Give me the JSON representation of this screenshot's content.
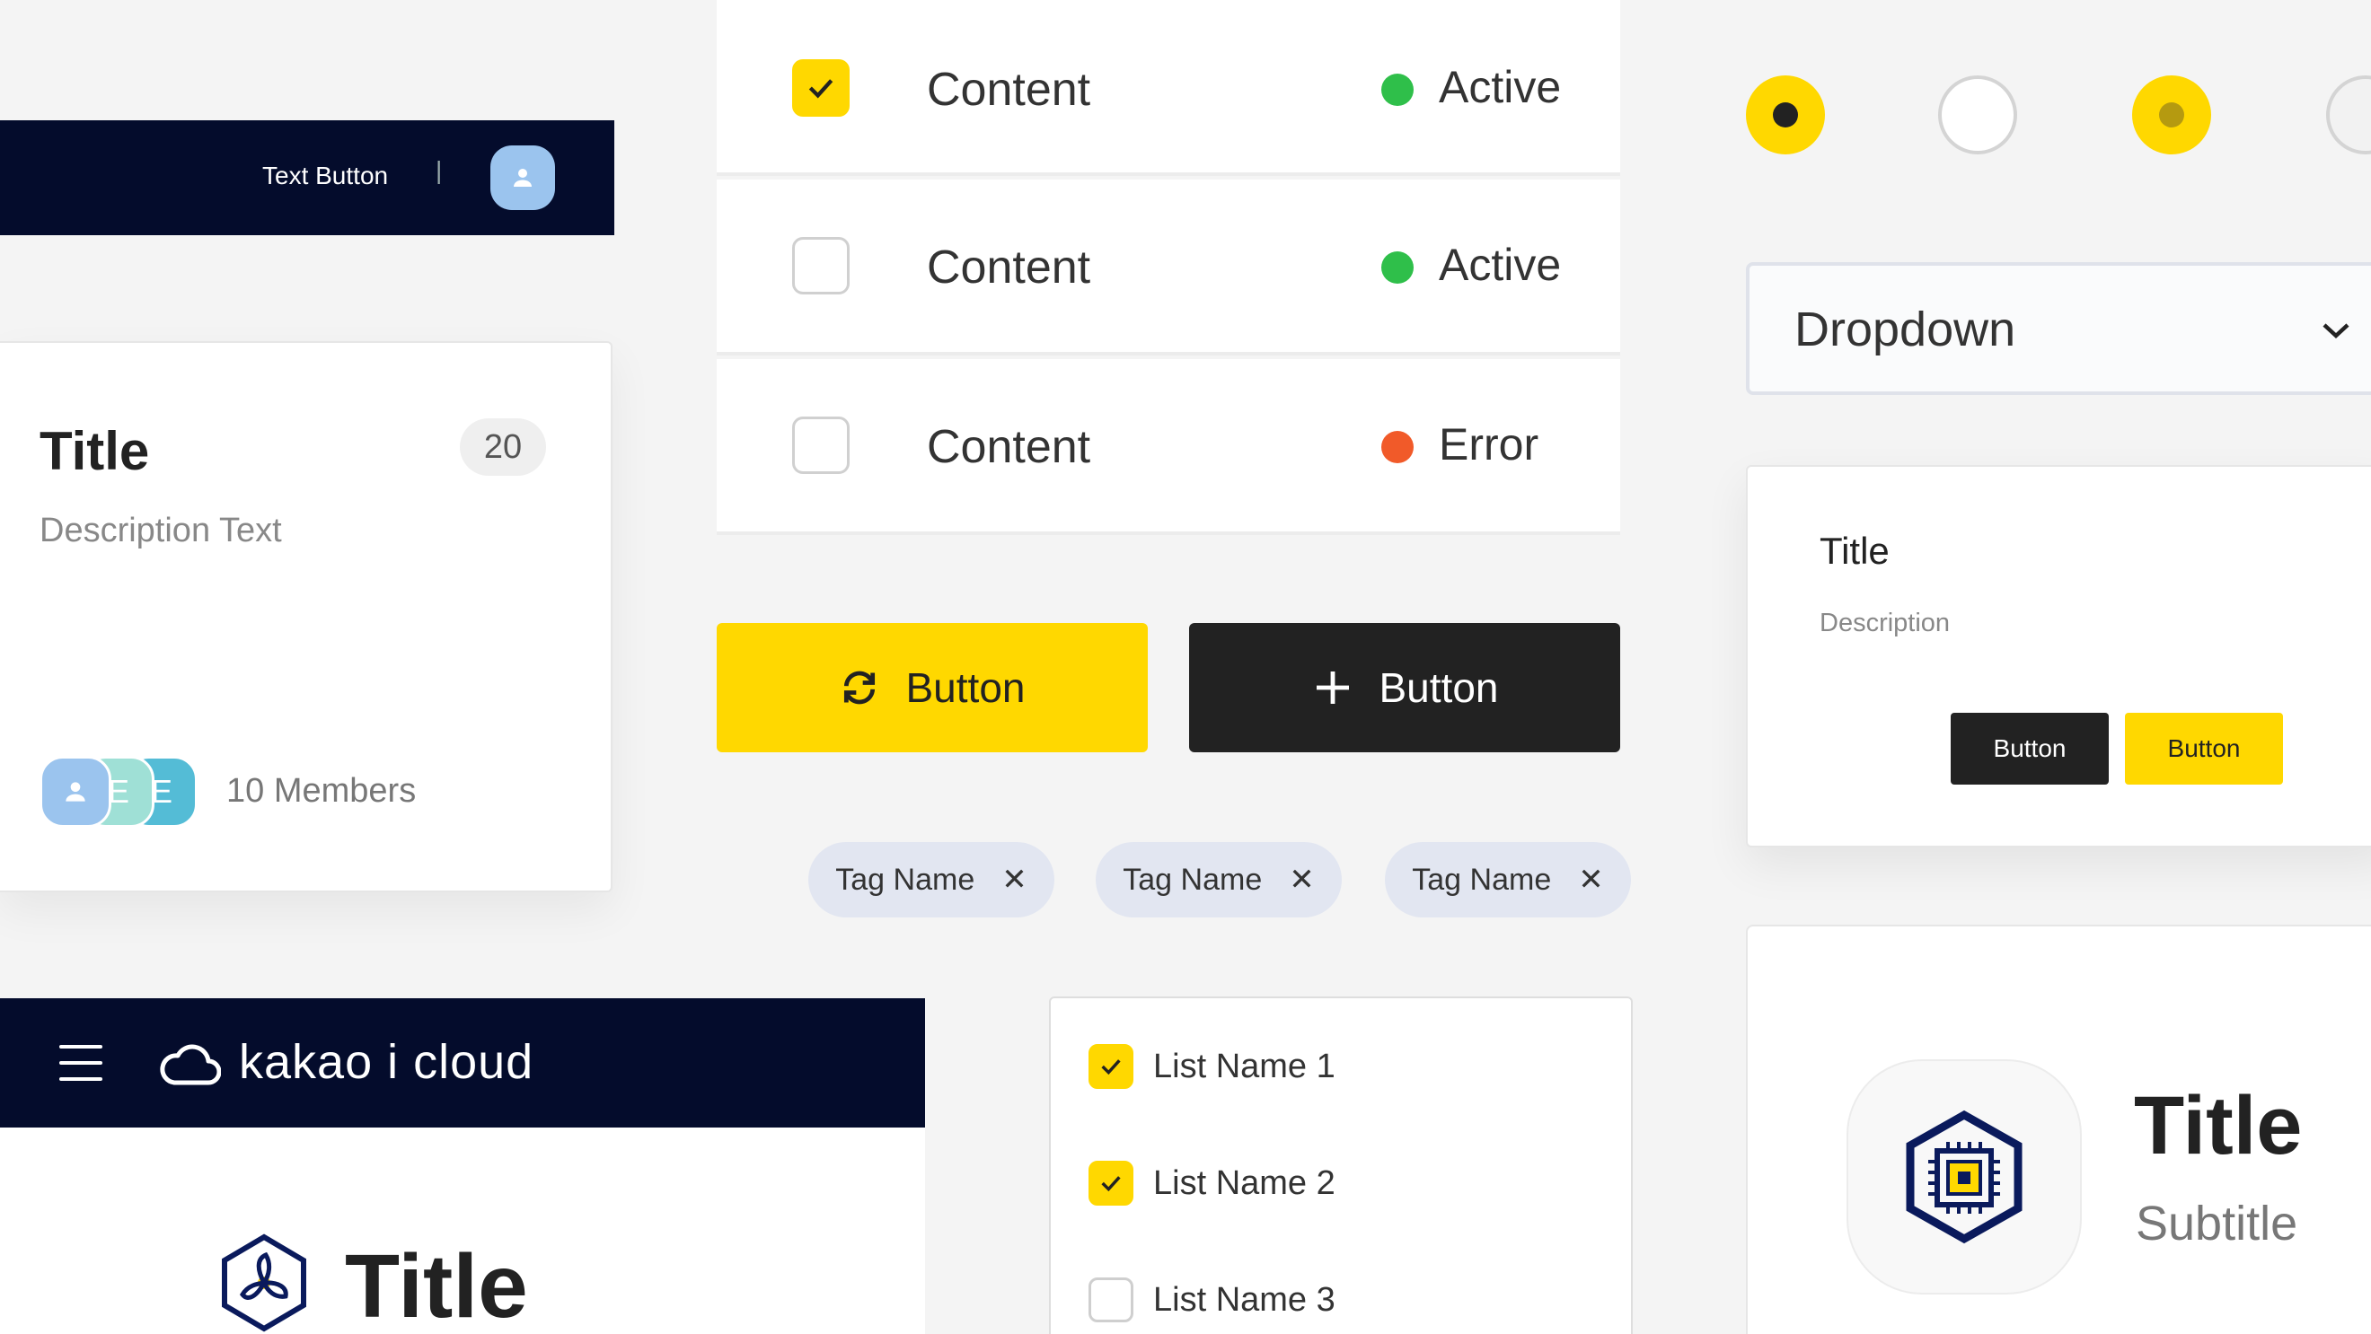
{
  "top_header": {
    "text_button": "Text Button",
    "separator": "|"
  },
  "member_card": {
    "title": "Title",
    "count": "20",
    "description": "Description Text",
    "members_label": "10 Members",
    "avatar_letters": [
      "E",
      "E"
    ]
  },
  "table": {
    "rows": [
      {
        "content": "Content",
        "checked": true,
        "status": "Active",
        "status_color": "#2fbf4a"
      },
      {
        "content": "Content",
        "checked": false,
        "status": "Active",
        "status_color": "#2fbf4a"
      },
      {
        "content": "Content",
        "checked": false,
        "status": "Error",
        "status_color": "#f15a29"
      }
    ]
  },
  "buttons": {
    "refresh_label": "Button",
    "add_label": "Button"
  },
  "tags": [
    {
      "label": "Tag Name"
    },
    {
      "label": "Tag Name"
    },
    {
      "label": "Tag Name"
    }
  ],
  "app_header": {
    "brand": "kakao i cloud"
  },
  "app_panel": {
    "title": "Title"
  },
  "list": {
    "items": [
      {
        "label": "List Name 1",
        "checked": true
      },
      {
        "label": "List Name 2",
        "checked": true
      },
      {
        "label": "List Name 3",
        "checked": false
      }
    ]
  },
  "radios": [
    {
      "state": "selected"
    },
    {
      "state": "unselected"
    },
    {
      "state": "selected-disabled"
    },
    {
      "state": "unselected-disabled"
    }
  ],
  "dropdown": {
    "label": "Dropdown"
  },
  "dialog_card": {
    "title": "Title",
    "description": "Description",
    "primary_button": "Button",
    "secondary_button": "Button"
  },
  "service_card": {
    "title": "Title",
    "subtitle": "Subtitle"
  },
  "colors": {
    "navy": "#040c2c",
    "yellow": "#ffd800",
    "dark": "#222222",
    "tag_bg": "#e2e6f1"
  }
}
